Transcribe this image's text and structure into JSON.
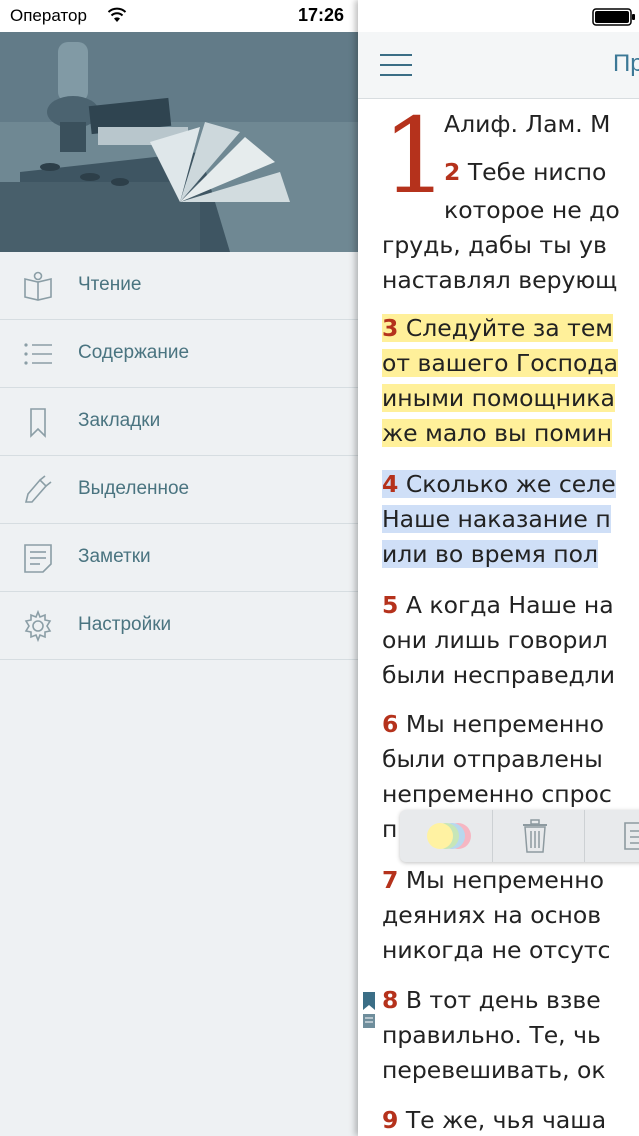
{
  "status": {
    "carrier": "Оператор",
    "time": "17:26"
  },
  "menu": {
    "items": [
      {
        "label": "Чтение",
        "icon": "book-icon"
      },
      {
        "label": "Содержание",
        "icon": "list-icon"
      },
      {
        "label": "Закладки",
        "icon": "bookmark-icon"
      },
      {
        "label": "Выделенное",
        "icon": "highlighter-icon"
      },
      {
        "label": "Заметки",
        "icon": "note-icon"
      },
      {
        "label": "Настройки",
        "icon": "gear-icon"
      }
    ]
  },
  "reader": {
    "title": "Пр",
    "chapter_number": "1",
    "lines": {
      "l1": "Алиф. Лам. М",
      "l2_num": "2",
      "l2_text": " Тебе ниспо",
      "l3": "которое не до",
      "l4": "грудь, дабы ты ув",
      "l5": "наставлял верующ",
      "v3_num": "3",
      "v3_1": " Следуйте за тем",
      "v3_2": "от вашего Господа",
      "v3_3": "иными помощника",
      "v3_4": "же мало вы помин",
      "v4_num": "4",
      "v4_1": " Сколько же селе",
      "v4_2": "Наше наказание п",
      "v4_3": "или во время пол",
      "v5_num": "5",
      "v5_1": " А когда Наше на",
      "v5_2": "они лишь говорил",
      "v5_3": "были несправедли",
      "v6_num": "6",
      "v6_1": " Мы непременно",
      "v6_2": "были отправлены",
      "v6_3": "непременно спрос",
      "v6_4": "п",
      "v7_num": "7",
      "v7_1": " Мы непременно",
      "v7_2": "деяниях на основ",
      "v7_3": "никогда не отсутс",
      "v8_num": "8",
      "v8_1": " В тот день взве",
      "v8_2": "правильно. Те, чь",
      "v8_3": "перевешивать, ок",
      "v9_num": "9",
      "v9_1": " Те же, чья чаша"
    }
  },
  "colors": {
    "accent": "#b5321c",
    "highlight_yellow": "#fff09a",
    "highlight_blue": "#cfdff7",
    "menu_text": "#4a7480",
    "nav_title": "#3b7896"
  }
}
